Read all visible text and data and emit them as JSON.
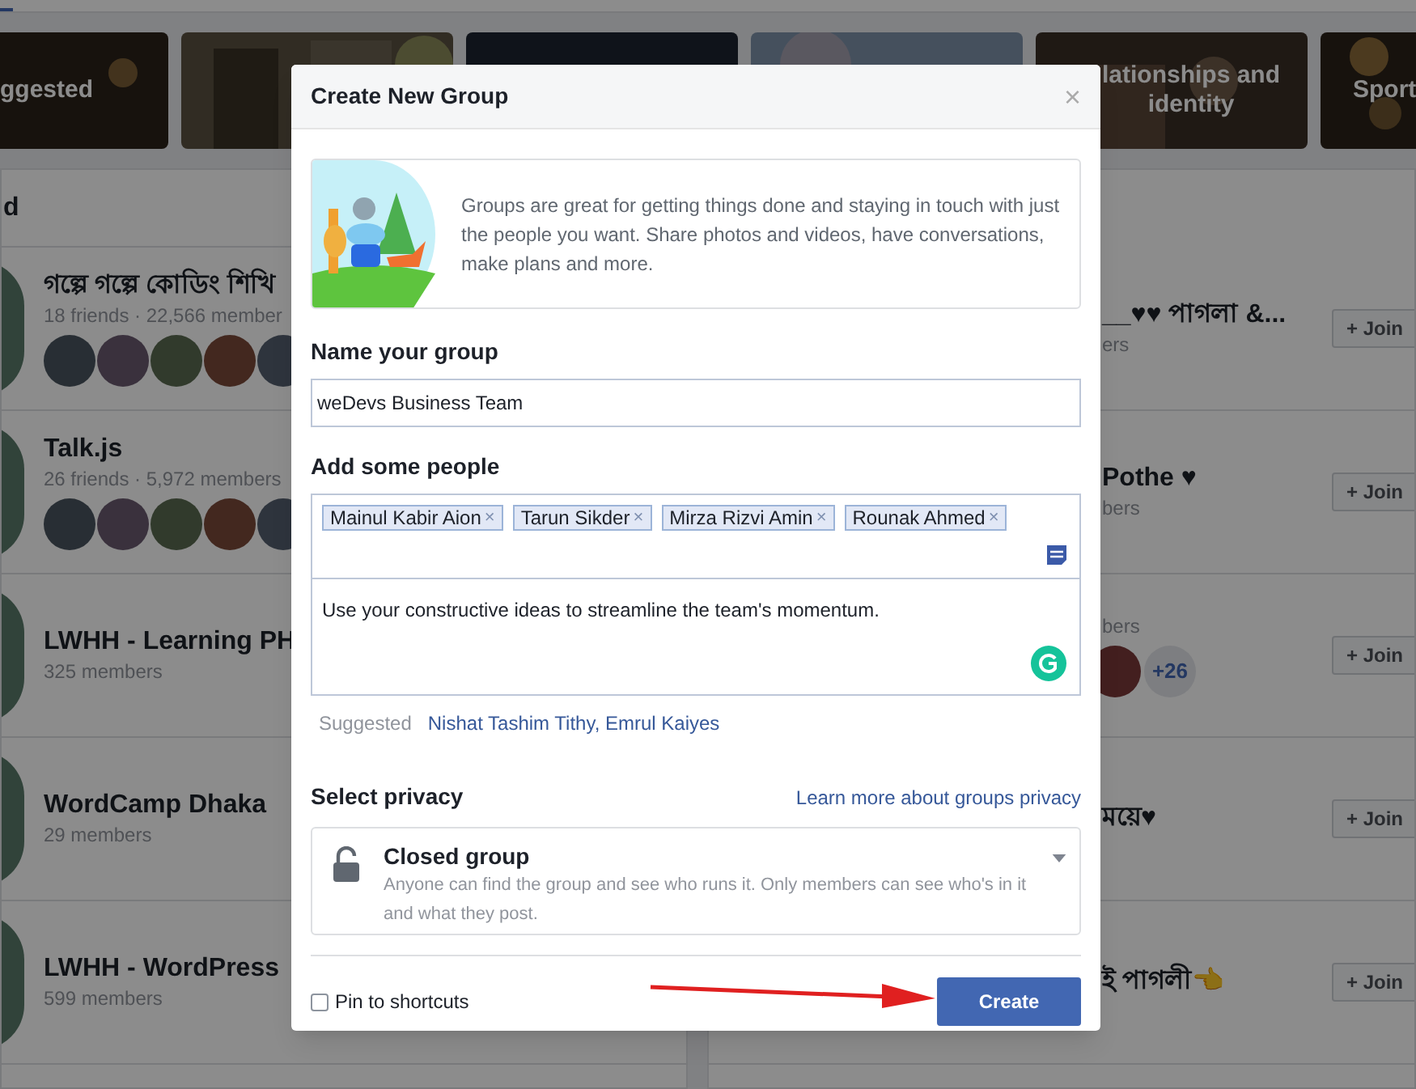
{
  "background": {
    "categories": [
      {
        "label": "ggested"
      },
      {
        "kind": "picture"
      },
      {
        "kind": "picture"
      },
      {
        "kind": "picture"
      },
      {
        "label": "lationships and identity"
      },
      {
        "label": "Sport"
      }
    ],
    "left_heading": "d",
    "left_groups": [
      {
        "name": "গল্পে গল্পে কোডিং শিখি",
        "meta": "18 friends · 22,566 member",
        "avatars": [
          {
            "kind": "picture"
          },
          {
            "kind": "picture"
          },
          {
            "kind": "picture"
          },
          {
            "kind": "picture"
          },
          {
            "kind": "picture"
          }
        ]
      },
      {
        "name": "Talk.js",
        "meta": "26 friends · 5,972 members",
        "avatars": [
          {
            "kind": "picture"
          },
          {
            "kind": "picture"
          },
          {
            "kind": "picture"
          },
          {
            "kind": "picture"
          },
          {
            "kind": "picture"
          }
        ]
      },
      {
        "name": "LWHH - Learning PH",
        "meta": "325 members"
      },
      {
        "name": "WordCamp Dhaka",
        "meta": "29 members"
      },
      {
        "name": "LWHH - WordPress",
        "meta": "599 members"
      }
    ],
    "right_groups": [
      {
        "name": "__♥♥ পাগলা &...",
        "meta": "ers",
        "join": "+ Join"
      },
      {
        "name": "Pothe ♥",
        "meta": "bers",
        "join": "+ Join"
      },
      {
        "meta": "bers",
        "more": "+26",
        "join": "+ Join"
      },
      {
        "name": "ময়ে♥",
        "join": "+ Join"
      },
      {
        "name": "ই পাগলী👈",
        "join": "+ Join"
      }
    ]
  },
  "dialog": {
    "title": "Create New Group",
    "close": "×",
    "intro": "Groups are great for getting things done and staying in touch with just the people you want. Share photos and videos, have conversations, make plans and more.",
    "name_label": "Name your group",
    "name_value": "weDevs Business Team",
    "people_label": "Add some people",
    "people": [
      {
        "name": "Mainul Kabir Aion",
        "remove": "×"
      },
      {
        "name": "Tarun Sikder",
        "remove": "×"
      },
      {
        "name": "Mirza Rizvi Amin",
        "remove": "×"
      },
      {
        "name": "Rounak Ahmed",
        "remove": "×"
      }
    ],
    "message": "Use your constructive ideas to streamline the team's momentum.",
    "suggested_label": "Suggested",
    "suggested_names": "Nishat Tashim Tithy, Emrul Kaiyes",
    "privacy_label": "Select privacy",
    "privacy_link": "Learn more about groups privacy",
    "privacy": {
      "title": "Closed group",
      "description": "Anyone can find the group and see who runs it. Only members can see who's in it and what they post."
    },
    "pin": {
      "label": "Pin to shortcuts",
      "checked": false
    },
    "create": "Create"
  }
}
